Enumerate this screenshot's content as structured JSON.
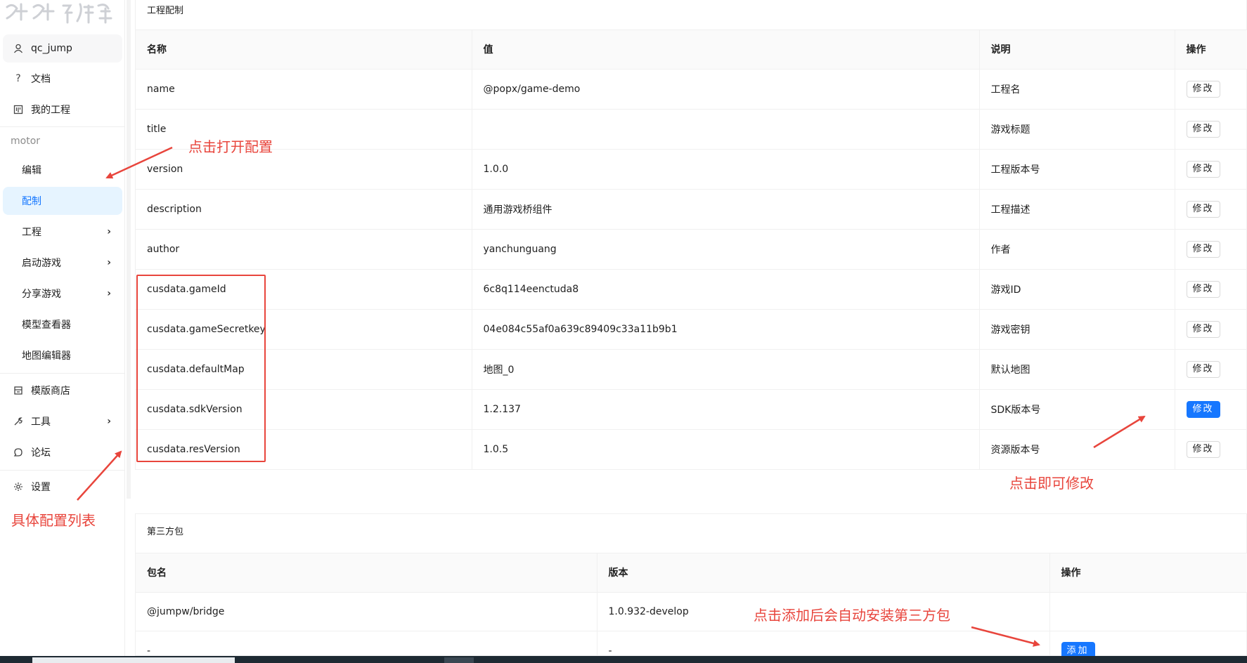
{
  "sidebar": {
    "user_name": "qc_jump",
    "docs_label": "文档",
    "my_projects_label": "我的工程",
    "group_title": "motor",
    "sub_items": [
      {
        "label": "编辑",
        "chevron": false
      },
      {
        "label": "配制",
        "chevron": false,
        "active": true
      },
      {
        "label": "工程",
        "chevron": true
      },
      {
        "label": "启动游戏",
        "chevron": true
      },
      {
        "label": "分享游戏",
        "chevron": true
      },
      {
        "label": "模型查看器",
        "chevron": false
      },
      {
        "label": "地图编辑器",
        "chevron": false
      }
    ],
    "template_store_label": "模版商店",
    "tools_label": "工具",
    "forum_label": "论坛",
    "settings_label": "设置"
  },
  "config_card": {
    "title": "工程配制",
    "columns": {
      "name": "名称",
      "value": "值",
      "desc": "说明",
      "action": "操作"
    },
    "edit_label": "修改",
    "rows": [
      {
        "name": "name",
        "value": "@popx/game-demo",
        "desc": "工程名"
      },
      {
        "name": "title",
        "value": "",
        "desc": "游戏标题"
      },
      {
        "name": "version",
        "value": "1.0.0",
        "desc": "工程版本号"
      },
      {
        "name": "description",
        "value": "通用游戏桥组件",
        "desc": "工程描述"
      },
      {
        "name": "author",
        "value": "yanchunguang",
        "desc": "作者"
      },
      {
        "name": "cusdata.gameId",
        "value": "6c8q114eenctuda8",
        "desc": "游戏ID"
      },
      {
        "name": "cusdata.gameSecretkey",
        "value": "04e084c55af0a639c89409c33a11b9b1",
        "desc": "游戏密钥"
      },
      {
        "name": "cusdata.defaultMap",
        "value": "地图_0",
        "desc": "默认地图"
      },
      {
        "name": "cusdata.sdkVersion",
        "value": "1.2.137",
        "desc": "SDK版本号",
        "highlight": true
      },
      {
        "name": "cusdata.resVersion",
        "value": "1.0.5",
        "desc": "资源版本号"
      }
    ]
  },
  "third_party_card": {
    "title": "第三方包",
    "columns": {
      "package": "包名",
      "version": "版本",
      "action": "操作"
    },
    "add_label": "添加",
    "rows": [
      {
        "package": "@jumpw/bridge",
        "version": "1.0.932-develop",
        "has_add": false
      },
      {
        "package": "-",
        "version": "-",
        "has_add": true
      }
    ]
  },
  "annotations": {
    "open_config": "点击打开配置",
    "config_list": "具体配置列表",
    "click_to_edit": "点击即可修改",
    "add_install": "点击添加后会自动安装第三方包",
    "color": "#e8453c"
  },
  "colors": {
    "accent": "#1677ff",
    "active_bg": "#e6f4ff",
    "annotation": "#e8453c"
  }
}
